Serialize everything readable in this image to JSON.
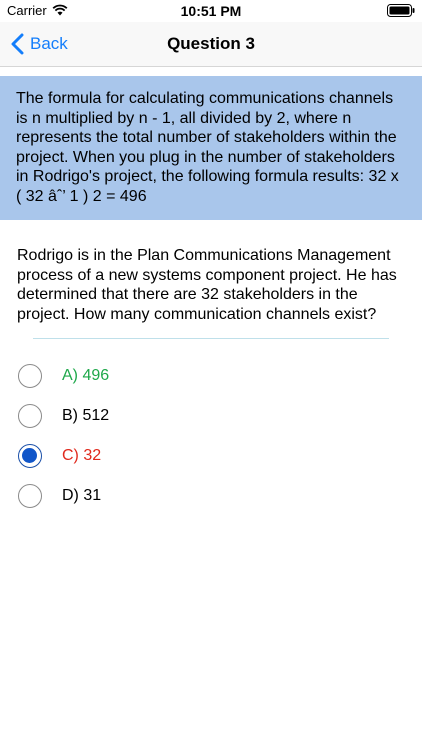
{
  "status_bar": {
    "carrier": "Carrier",
    "time": "10:51 PM"
  },
  "nav": {
    "back_label": "Back",
    "title": "Question 3"
  },
  "explanation": "The formula for calculating communications channels is n multiplied by n - 1, all divided by 2, where n represents the total number of stakeholders within the project. When you plug in the number of stakeholders in Rodrigo's project, the following formula results: 32 x ( 32 âˆ’ 1 ) 2 = 496",
  "question": "Rodrigo is in the Plan Communications Management process of a new systems component project. He has determined that there are 32 stakeholders in the project. How many communication channels exist?",
  "options": [
    {
      "label": "A) 496",
      "state": "correct",
      "color": "#1ea84a"
    },
    {
      "label": "B) 512",
      "state": "normal",
      "color": "#000000"
    },
    {
      "label": "C) 32",
      "state": "selected-wrong",
      "color": "#e0281c"
    },
    {
      "label": "D) 31",
      "state": "normal",
      "color": "#000000"
    }
  ],
  "colors": {
    "accent": "#147efb",
    "explanation_bg": "#a9c6eb",
    "selected_radio": "#1156c9"
  },
  "icons": [
    "wifi-icon",
    "battery-icon",
    "chevron-left-icon",
    "radio-icon"
  ]
}
